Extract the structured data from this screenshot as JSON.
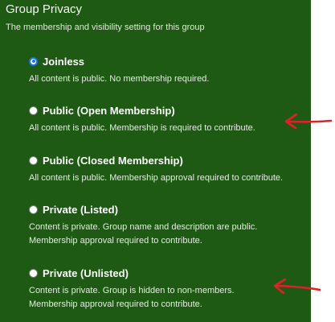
{
  "section": {
    "title": "Group Privacy",
    "description": "The membership and visibility setting for this group"
  },
  "options": [
    {
      "label": "Joinless",
      "description": [
        "All content is public. No membership required."
      ],
      "selected": true
    },
    {
      "label": "Public (Open Membership)",
      "description": [
        "All content is public. Membership is required to contribute."
      ],
      "selected": false
    },
    {
      "label": "Public (Closed Membership)",
      "description": [
        "All content is public. Membership approval required to contribute."
      ],
      "selected": false
    },
    {
      "label": "Private (Listed)",
      "description": [
        "Content is private. Group name and description are public.",
        "Membership approval required to contribute."
      ],
      "selected": false
    },
    {
      "label": "Private (Unlisted)",
      "description": [
        "Content is private. Group is hidden to non-members.",
        "Membership approval required to contribute."
      ],
      "selected": false
    }
  ],
  "colors": {
    "panel_background": "#1e5a14",
    "annotation_arrow": "#e0202a",
    "radio_selected": "#1a73e8"
  }
}
